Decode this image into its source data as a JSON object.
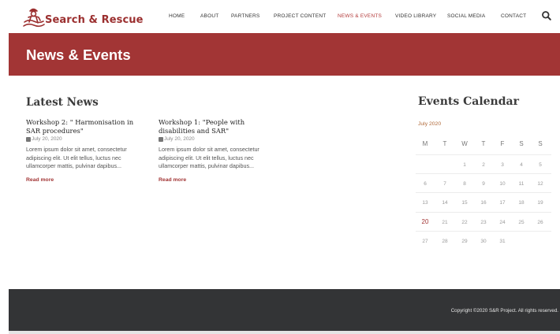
{
  "brand": {
    "name": "Search & Rescue",
    "color": "#9b2f2f"
  },
  "nav": {
    "items": [
      {
        "label": "HOME",
        "active": false
      },
      {
        "label": "ABOUT",
        "active": false
      },
      {
        "label": "PARTNERS",
        "active": false
      },
      {
        "label": "PROJECT CONTENT",
        "active": false
      },
      {
        "label": "NEWS & EVENTS",
        "active": true
      },
      {
        "label": "VIDEO LIBRARY",
        "active": false
      },
      {
        "label": "SOCIAL MEDIA",
        "active": false
      },
      {
        "label": "CONTACT",
        "active": false
      }
    ],
    "search_icon": "search-icon"
  },
  "banner": {
    "title": "News & Events",
    "color": "#a23535"
  },
  "latest_news": {
    "title": "Latest News",
    "posts": [
      {
        "title": "Workshop 2: \" Harmonisation in SAR procedures\"",
        "date": "July 20, 2020",
        "excerpt": "Lorem ipsum dolor sit amet, consectetur adipiscing elit. Ut elit tellus, luctus nec ullamcorper mattis, pulvinar dapibus...",
        "read_more": "Read more"
      },
      {
        "title": "Workshop 1: \"People with disabilities and SAR\"",
        "date": "July 20, 2020",
        "excerpt": "Lorem ipsum dolor sit amet, consectetur adipiscing elit. Ut elit tellus, luctus nec ullamcorper mattis, pulvinar dapibus...",
        "read_more": "Read more"
      }
    ]
  },
  "events_calendar": {
    "title": "Events Calendar",
    "month": "July 2020",
    "weekdays": [
      "M",
      "T",
      "W",
      "T",
      "F",
      "S",
      "S"
    ],
    "weeks": [
      [
        "",
        "",
        "1",
        "2",
        "3",
        "4",
        "5"
      ],
      [
        "6",
        "7",
        "8",
        "9",
        "10",
        "11",
        "12"
      ],
      [
        "13",
        "14",
        "15",
        "16",
        "17",
        "18",
        "19"
      ],
      [
        "20",
        "21",
        "22",
        "23",
        "24",
        "25",
        "26"
      ],
      [
        "27",
        "28",
        "29",
        "30",
        "31",
        "",
        ""
      ]
    ],
    "highlighted_day": "20"
  },
  "footer": {
    "copyright": "Copyright ©2020 S&R Project. All rights reserved."
  }
}
